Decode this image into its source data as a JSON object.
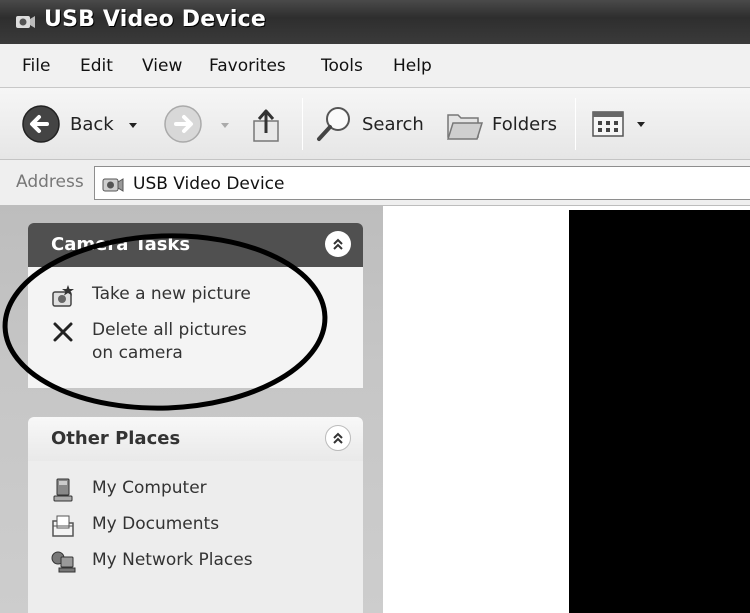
{
  "window": {
    "title": "USB Video Device"
  },
  "menu": [
    "File",
    "Edit",
    "View",
    "Favorites",
    "Tools",
    "Help"
  ],
  "toolbar": {
    "back_label": "Back",
    "search_label": "Search",
    "folders_label": "Folders"
  },
  "address": {
    "label": "Address",
    "value": "USB Video Device"
  },
  "camera_tasks": {
    "title": "Camera Tasks",
    "items": [
      {
        "label": "Take a new picture",
        "icon": "camera-snapshot-icon"
      },
      {
        "label": "Delete all pictures on camera",
        "icon": "delete-x-icon"
      }
    ]
  },
  "other_places": {
    "title": "Other Places",
    "items": [
      {
        "label": "My Computer",
        "icon": "computer-icon"
      },
      {
        "label": "My Documents",
        "icon": "documents-icon"
      },
      {
        "label": "My Network Places",
        "icon": "network-places-icon"
      }
    ]
  },
  "colors": {
    "titlebar": "#3a3a3a",
    "panel_header_dark": "#505050",
    "preview": "#000000"
  }
}
